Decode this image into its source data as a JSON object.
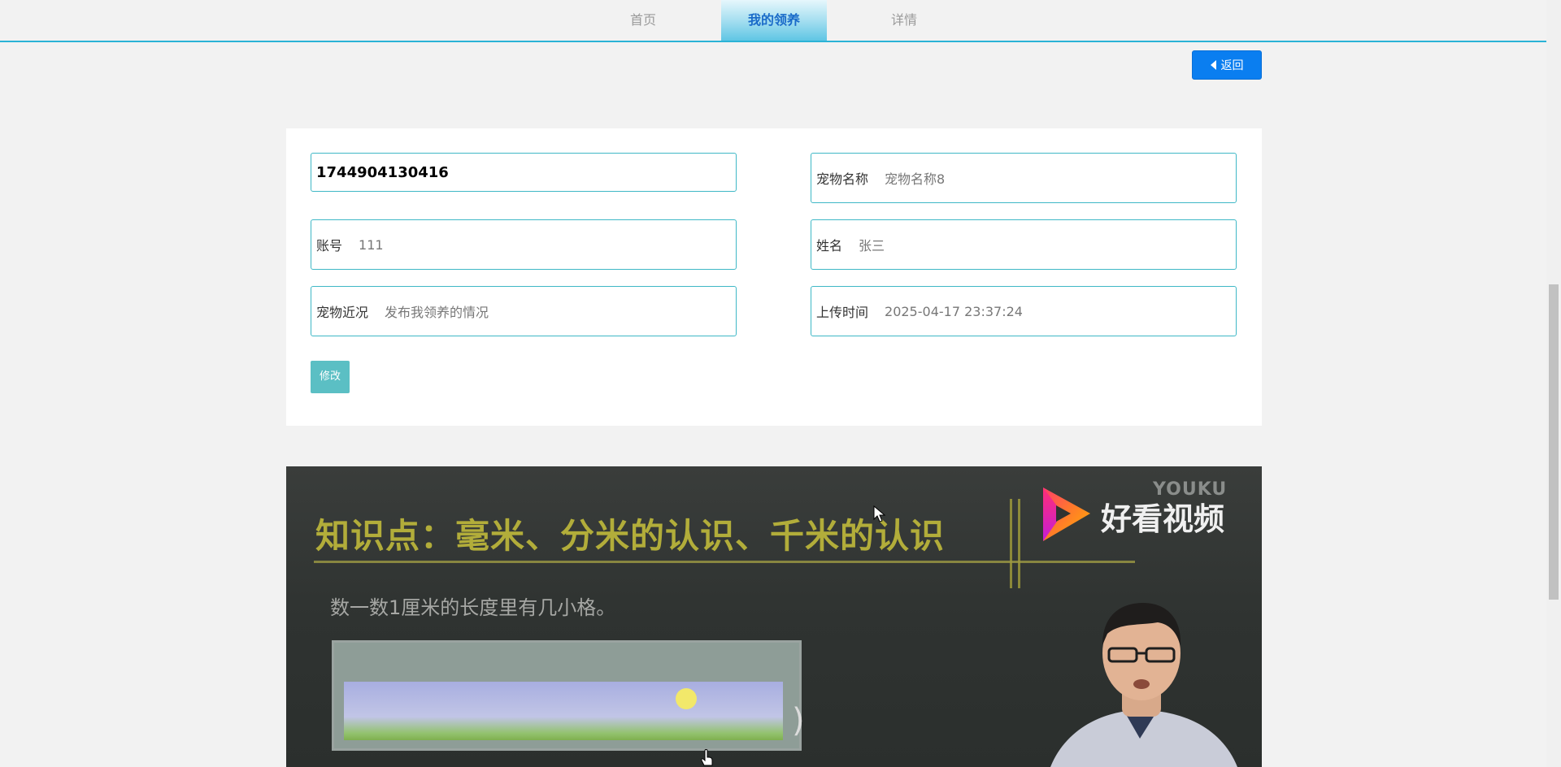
{
  "nav": {
    "tabs": [
      {
        "label": "首页"
      },
      {
        "label": "我的领养"
      },
      {
        "label": "详情"
      }
    ],
    "active_color": "#1a6bc9"
  },
  "back_button": {
    "label": "返回",
    "icon": "caret-left-icon"
  },
  "form": {
    "id_value": "1744904130416",
    "pet_name": {
      "label": "宠物名称",
      "value": "宠物名称8"
    },
    "account": {
      "label": "账号",
      "value": "111"
    },
    "name": {
      "label": "姓名",
      "value": "张三"
    },
    "pet_status": {
      "label": "宠物近况",
      "value": "发布我领养的情况"
    },
    "upload_time": {
      "label": "上传时间",
      "value": "2025-04-17 23:37:24"
    },
    "modify_label": "修改"
  },
  "video": {
    "headline": "知识点：毫米、分米的认识、千米的认识",
    "subtitle": "数一数1厘米的长度里有几小格。",
    "logo_text": "好看视频",
    "watermark": "YOUKU",
    "paren": ")"
  },
  "colors": {
    "accent": "#2bb3d6",
    "field_border": "#3fb8c6",
    "primary_button": "#0a7ef0",
    "modify_button": "#5bbfc4"
  }
}
